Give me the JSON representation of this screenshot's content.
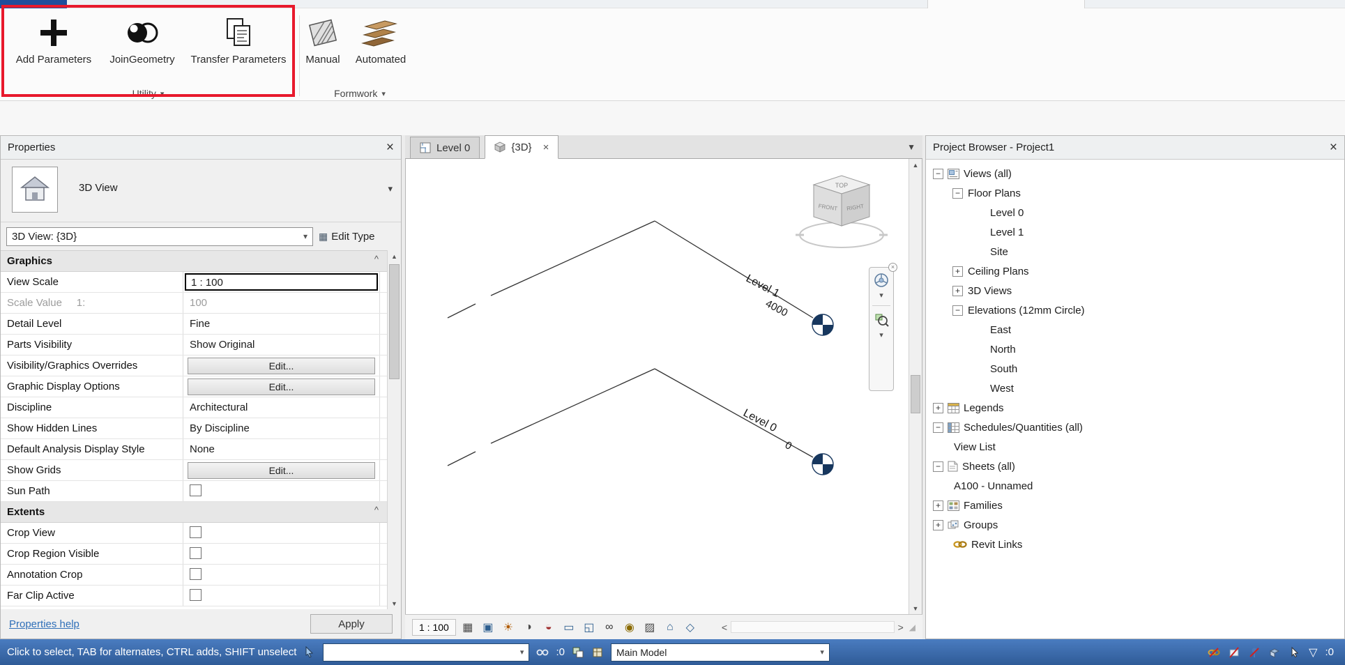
{
  "colors": {
    "accent_red": "#e8192c",
    "status_blue": "#4a7cc0",
    "status_blue_dark": "#2f5b97",
    "level_navy": "#17375e",
    "help_link_blue": "#2f6fb8",
    "selection_border": "#000000"
  },
  "icons": {
    "close": "×",
    "dropdown": "▾",
    "dropdown_big": "▼",
    "collapse": "^",
    "plus": "+",
    "minus": "−",
    "scroll_up": "▲",
    "scroll_down": "▼",
    "scroll_left": "<",
    "scroll_right": ">",
    "funnel": "▽",
    "grip": "◢",
    "edit_type_grid": "▦"
  },
  "ribbon": {
    "groups": [
      {
        "label": "Utility",
        "buttons": [
          "Add Parameters",
          "JoinGeometry",
          "Transfer Parameters"
        ]
      },
      {
        "label": "Formwork",
        "buttons": [
          "Manual",
          "Automated"
        ]
      }
    ]
  },
  "properties": {
    "title": "Properties",
    "type_label": "3D View",
    "selector_value": "3D View: {3D}",
    "edit_type": "Edit Type",
    "rows": [
      {
        "label": "Graphics"
      },
      {
        "label": "View Scale",
        "value": "1 : 100"
      },
      {
        "label": "Scale Value     1:",
        "value": "100"
      },
      {
        "label": "Detail Level",
        "value": "Fine"
      },
      {
        "label": "Parts Visibility",
        "value": "Show Original"
      },
      {
        "label": "Visibility/Graphics Overrides",
        "value": "Edit..."
      },
      {
        "label": "Graphic Display Options",
        "value": "Edit..."
      },
      {
        "label": "Discipline",
        "value": "Architectural"
      },
      {
        "label": "Show Hidden Lines",
        "value": "By Discipline"
      },
      {
        "label": "Default Analysis Display Style",
        "value": "None"
      },
      {
        "label": "Show Grids",
        "value": "Edit..."
      },
      {
        "label": "Sun Path",
        "value": ""
      },
      {
        "label": "Extents"
      },
      {
        "label": "Crop View",
        "value": ""
      },
      {
        "label": "Crop Region Visible",
        "value": ""
      },
      {
        "label": "Annotation Crop",
        "value": ""
      },
      {
        "label": "Far Clip Active",
        "value": ""
      }
    ],
    "help_link": "Properties help",
    "apply": "Apply"
  },
  "drawing": {
    "tabs": [
      {
        "label": "Level 0"
      },
      {
        "label": "{3D}"
      }
    ],
    "levels": [
      {
        "name": "Level 1",
        "elevation": "4000"
      },
      {
        "name": "Level 0",
        "elevation": "0"
      }
    ],
    "viewcube": {
      "top": "TOP",
      "front": "FRONT",
      "right": "RIGHT"
    },
    "view_bar": {
      "scale": "1 : 100",
      "icons": [
        {
          "name": "detail-level",
          "glyph": "▦"
        },
        {
          "name": "visual-style",
          "glyph": "▣"
        },
        {
          "name": "sun-path",
          "glyph": "☀"
        },
        {
          "name": "shadows",
          "glyph": "◑"
        },
        {
          "name": "render",
          "glyph": "◒"
        },
        {
          "name": "crop-view",
          "glyph": "▭"
        },
        {
          "name": "show-crop-region",
          "glyph": "◱"
        },
        {
          "name": "temporary-hide-isolate",
          "glyph": "∞"
        },
        {
          "name": "reveal-hidden-elements",
          "glyph": "◉"
        },
        {
          "name": "temporary-view-properties",
          "glyph": "▨"
        },
        {
          "name": "analytical-model",
          "glyph": "⌂"
        },
        {
          "name": "reveal-constraints",
          "glyph": "◇"
        }
      ]
    }
  },
  "project_browser": {
    "title": "Project Browser - Project1",
    "tree": [
      {
        "label": "Views (all)"
      },
      {
        "label": "Floor Plans"
      },
      {
        "label": "Level 0"
      },
      {
        "label": "Level 1"
      },
      {
        "label": "Site"
      },
      {
        "label": "Ceiling Plans"
      },
      {
        "label": "3D Views"
      },
      {
        "label": "Elevations (12mm Circle)"
      },
      {
        "label": "East"
      },
      {
        "label": "North"
      },
      {
        "label": "South"
      },
      {
        "label": "West"
      },
      {
        "label": "Legends"
      },
      {
        "label": "Schedules/Quantities (all)"
      },
      {
        "label": "View List"
      },
      {
        "label": "Sheets (all)"
      },
      {
        "label": "A100 - Unnamed"
      },
      {
        "label": "Families"
      },
      {
        "label": "Groups"
      },
      {
        "label": "Revit Links"
      }
    ]
  },
  "status_bar": {
    "hint": "Click to select, TAB for alternates, CTRL adds, SHIFT unselect",
    "selection_count": ":0",
    "active_workset": "",
    "design_option": "Main Model",
    "filter_count": ":0"
  }
}
